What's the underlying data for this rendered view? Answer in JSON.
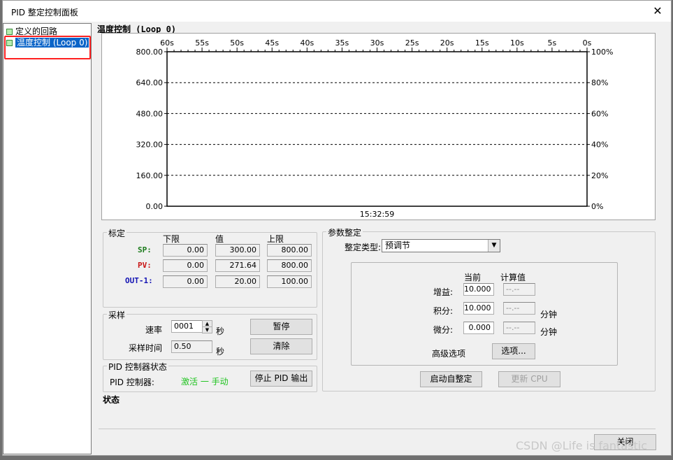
{
  "window": {
    "title": "PID 整定控制面板",
    "close_glyph": "✕"
  },
  "tree": {
    "items": [
      {
        "label": "定义的回路"
      },
      {
        "label": "温度控制 (Loop 0)",
        "selected": true
      }
    ]
  },
  "chart_title": "温度控制 (Loop 0)",
  "chart_data": {
    "type": "line",
    "x_ticks": [
      "60s",
      "55s",
      "50s",
      "45s",
      "40s",
      "35s",
      "30s",
      "25s",
      "20s",
      "15s",
      "10s",
      "5s",
      "0s"
    ],
    "y_left_ticks": [
      "800.00",
      "640.00",
      "480.00",
      "320.00",
      "160.00",
      "0.00"
    ],
    "y_right_ticks": [
      "100%",
      "80%",
      "60%",
      "40%",
      "20%",
      "0%"
    ],
    "ylim": [
      0,
      800
    ],
    "time_label": "15:32:59",
    "grid": true,
    "series": []
  },
  "calibration": {
    "legend": "标定",
    "col_low": "下限",
    "col_value": "值",
    "col_high": "上限",
    "rows": [
      {
        "label": "SP:",
        "low": "0.00",
        "value": "300.00",
        "high": "800.00",
        "color": "#1a7a1a"
      },
      {
        "label": "PV:",
        "low": "0.00",
        "value": "271.64",
        "high": "800.00",
        "color": "#c81414"
      },
      {
        "label": "OUT-1:",
        "low": "0.00",
        "value": "20.00",
        "high": "100.00",
        "color": "#1414b4"
      }
    ]
  },
  "sampling": {
    "legend": "采样",
    "rate_label": "速率",
    "rate_value": "0001",
    "rate_unit": "秒",
    "time_label": "采样时间",
    "time_value": "0.50",
    "time_unit": "秒",
    "pause_button": "暂停",
    "clear_button": "清除"
  },
  "pid_status": {
    "legend": "PID 控制器状态",
    "controller_label": "PID 控制器:",
    "state_text": "激活 一 手动",
    "state_color": "#22c422",
    "stop_button": "停止 PID 输出"
  },
  "status_label": "状态",
  "tuning": {
    "legend": "参数整定",
    "type_label": "整定类型:",
    "type_value": "预调节",
    "col_current": "当前",
    "col_calc": "计算值",
    "gain_label": "增益:",
    "gain_current": "10.000",
    "gain_calc": "--.--",
    "integral_label": "积分:",
    "integral_current": "10.000",
    "integral_calc": "--.--",
    "integral_unit": "分钟",
    "derivative_label": "微分:",
    "derivative_current": "0.000",
    "derivative_calc": "--.--",
    "derivative_unit": "分钟",
    "advanced_label": "高级选项",
    "options_button": "选项...",
    "auto_tune_button": "启动自整定",
    "update_cpu_button": "更新 CPU"
  },
  "close_button": "关闭",
  "watermark": "CSDN @Life is fantastic"
}
